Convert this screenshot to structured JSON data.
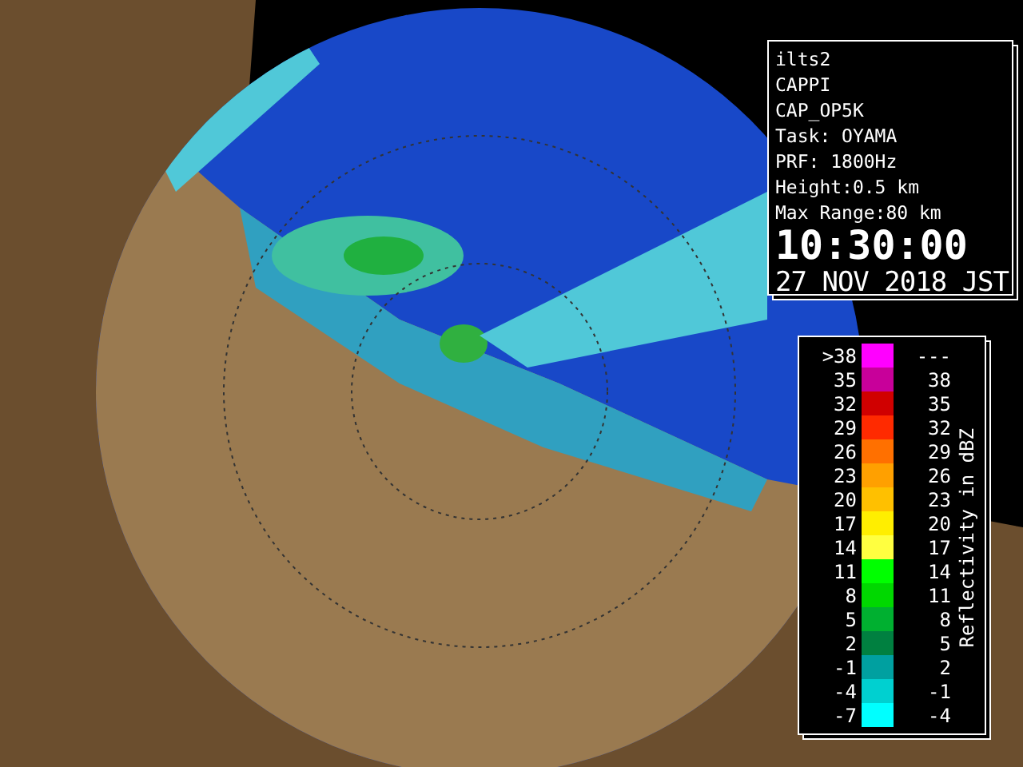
{
  "info_panel": {
    "lines": [
      "ilts2",
      "CAPPI",
      "CAP_OP5K",
      "Task: OYAMA",
      "PRF: 1800Hz",
      "Height:0.5 km",
      "Max Range:80 km"
    ],
    "time": "10:30:00",
    "date": "27 NOV 2018 JST"
  },
  "legend": {
    "title": "Reflectivity in dBZ",
    "rows": [
      {
        "low": ">38",
        "high": "---",
        "color": "#ff00ff"
      },
      {
        "low": "35",
        "high": "38",
        "color": "#c8009a"
      },
      {
        "low": "32",
        "high": "35",
        "color": "#d00000"
      },
      {
        "low": "29",
        "high": "32",
        "color": "#ff2a00"
      },
      {
        "low": "26",
        "high": "29",
        "color": "#ff7000"
      },
      {
        "low": "23",
        "high": "26",
        "color": "#ffa000"
      },
      {
        "low": "20",
        "high": "23",
        "color": "#ffc000"
      },
      {
        "low": "17",
        "high": "20",
        "color": "#ffee00"
      },
      {
        "low": "14",
        "high": "17",
        "color": "#ffff40"
      },
      {
        "low": "11",
        "high": "14",
        "color": "#00ff00"
      },
      {
        "low": "8",
        "high": "11",
        "color": "#00d800"
      },
      {
        "low": "5",
        "high": "8",
        "color": "#00b030"
      },
      {
        "low": "2",
        "high": "5",
        "color": "#008040"
      },
      {
        "low": "-1",
        "high": "2",
        "color": "#00a0a0"
      },
      {
        "low": "-4",
        "high": "-1",
        "color": "#00d0d0"
      },
      {
        "low": "-7",
        "high": "-4",
        "color": "#00ffff"
      }
    ]
  }
}
